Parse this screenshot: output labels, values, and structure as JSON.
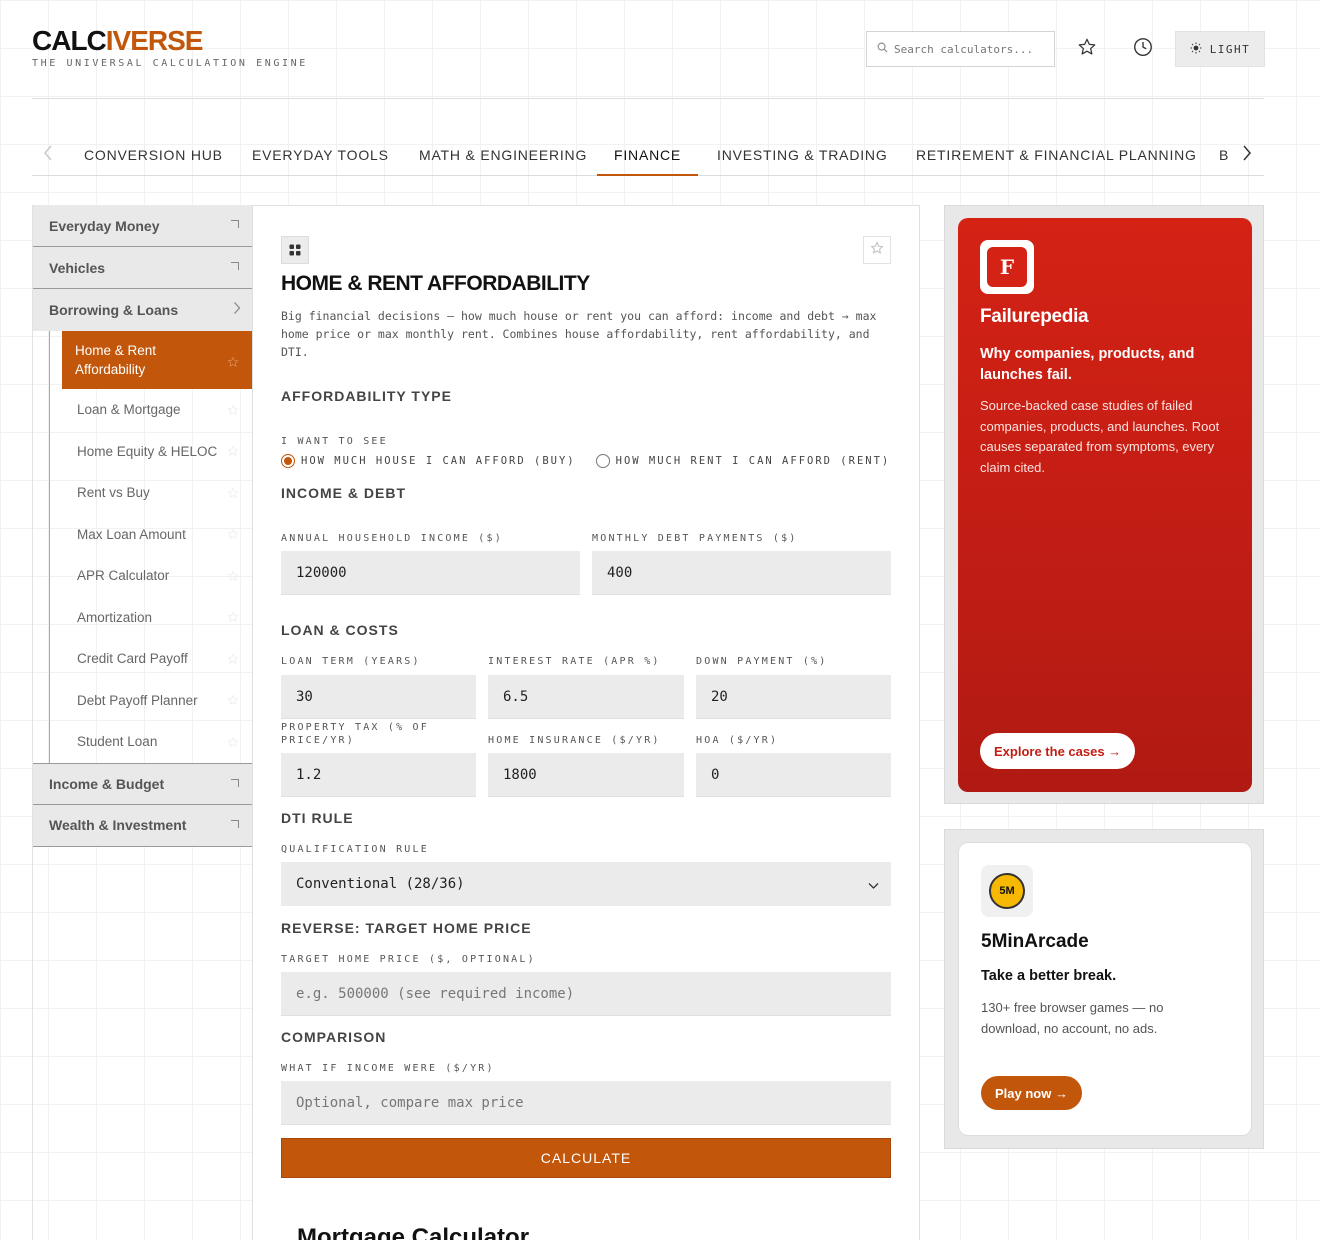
{
  "header": {
    "logo_a": "CALC",
    "logo_b": "IVERSE",
    "tagline": "THE UNIVERSAL CALCULATION ENGINE",
    "search_placeholder": "Search calculators...",
    "theme_label": "LIGHT"
  },
  "tabs": [
    "CONVERSION HUB",
    "EVERYDAY TOOLS",
    "MATH & ENGINEERING",
    "FINANCE",
    "INVESTING & TRADING",
    "RETIREMENT & FINANCIAL PLANNING",
    "B"
  ],
  "active_tab": "FINANCE",
  "sidebar": {
    "cat_everyday": "Everyday Money",
    "cat_vehicles": "Vehicles",
    "cat_borrowing": "Borrowing & Loans",
    "items": [
      "Home & Rent Affordability",
      "Loan & Mortgage",
      "Home Equity & HELOC",
      "Rent vs Buy",
      "Max Loan Amount",
      "APR Calculator",
      "Amortization",
      "Credit Card Payoff",
      "Debt Payoff Planner",
      "Student Loan"
    ],
    "cat_income": "Income & Budget",
    "cat_wealth": "Wealth & Investment"
  },
  "calculator": {
    "title": "HOME & RENT AFFORDABILITY",
    "description": "Big financial decisions — how much house or rent you can afford: income and debt → max home price or max monthly rent. Combines house affordability, rent affordability, and DTI.",
    "sec_type": "AFFORDABILITY TYPE",
    "want_label": "I WANT TO SEE",
    "radio_buy": "HOW MUCH HOUSE I CAN AFFORD (BUY)",
    "radio_rent": "HOW MUCH RENT I CAN AFFORD (RENT)",
    "sec_income": "INCOME & DEBT",
    "income_label": "ANNUAL HOUSEHOLD INCOME ($)",
    "income_value": "120000",
    "debt_label": "MONTHLY DEBT PAYMENTS ($)",
    "debt_value": "400",
    "sec_loan": "LOAN & COSTS",
    "term_label": "LOAN TERM (YEARS)",
    "term_value": "30",
    "rate_label": "INTEREST RATE (APR %)",
    "rate_value": "6.5",
    "down_label": "DOWN PAYMENT (%)",
    "down_value": "20",
    "tax_label": "PROPERTY TAX (% OF PRICE/YR)",
    "tax_value": "1.2",
    "ins_label": "HOME INSURANCE ($/YR)",
    "ins_value": "1800",
    "hoa_label": "HOA ($/YR)",
    "hoa_value": "0",
    "sec_dti": "DTI RULE",
    "qual_label": "QUALIFICATION RULE",
    "qual_value": "Conventional (28/36)",
    "sec_reverse": "REVERSE: TARGET HOME PRICE",
    "target_label": "TARGET HOME PRICE ($, OPTIONAL)",
    "target_placeholder": "e.g. 500000 (see required income)",
    "sec_compare": "COMPARISON",
    "whatif_label": "WHAT IF INCOME WERE ($/YR)",
    "whatif_placeholder": "Optional, compare max price",
    "calculate_label": "CALCULATE",
    "next_title": "Mortgage Calculator"
  },
  "ads": {
    "ad1_logo": "F",
    "ad1_name": "Failurepedia",
    "ad1_head": "Why companies, products, and launches fail.",
    "ad1_body": "Source-backed case studies of failed companies, products, and launches. Root causes separated from symptoms, every claim cited.",
    "ad1_cta": "Explore the cases →",
    "ad2_logo": "5M",
    "ad2_name": "5MinArcade",
    "ad2_head": "Take a better break.",
    "ad2_body": "130+ free browser games — no download, no account, no ads.",
    "ad2_cta": "Play now →"
  },
  "colors": {
    "accent": "#c2560a",
    "ad_red": "#d42215"
  }
}
